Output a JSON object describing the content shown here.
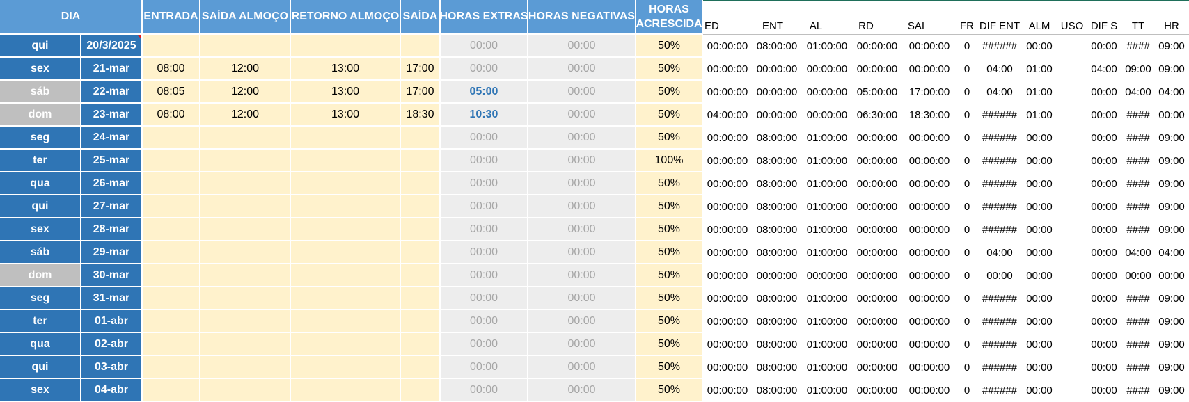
{
  "header": {
    "dia": "DIA",
    "entrada": "ENTRADA",
    "saida_almoco": "SAÍDA ALMOÇO",
    "retorno_almoco": "RETORNO ALMOÇO",
    "saida": "SAÍDA",
    "horas_extras": "HORAS EXTRAS",
    "horas_negativas": "HORAS NEGATIVAS",
    "horas_acrescida_1": "HORAS",
    "horas_acrescida_2": "ACRESCIDA"
  },
  "aux_header": {
    "ed": "ED",
    "ent": "ENT",
    "al": "AL",
    "rd": "RD",
    "sai": "SAI",
    "fr": "FR",
    "dif_ent": "DIF ENT",
    "alm": "ALM",
    "uso": "USO",
    "dif_s": "DIF S",
    "tt": "TT",
    "hr": "HR"
  },
  "colors": {
    "header_blue": "#5b9bd5",
    "day_blue": "#2f75b5",
    "weekend_gray": "#bfbfbf",
    "input_yellow": "#fff2cc",
    "calc_gray": "#ededed"
  },
  "rows": [
    {
      "day": "qui",
      "date": "20/3/2025",
      "entrada": "",
      "saida_almoco": "",
      "retorno": "",
      "saida": "",
      "extras": "00:00",
      "negativas": "00:00",
      "pct": "50%",
      "ed": "00:00:00",
      "ent": "08:00:00",
      "al": "01:00:00",
      "rd": "00:00:00",
      "sai": "00:00:00",
      "fr": "0",
      "dif_ent": "######",
      "alm": "00:00",
      "uso": "",
      "dif_s": "00:00",
      "tt": "####",
      "hr": "09:00",
      "weekend": false,
      "extras_hi": false
    },
    {
      "day": "sex",
      "date": "21-mar",
      "entrada": "08:00",
      "saida_almoco": "12:00",
      "retorno": "13:00",
      "saida": "17:00",
      "extras": "00:00",
      "negativas": "00:00",
      "pct": "50%",
      "ed": "00:00:00",
      "ent": "00:00:00",
      "al": "00:00:00",
      "rd": "00:00:00",
      "sai": "00:00:00",
      "fr": "0",
      "dif_ent": "04:00",
      "alm": "01:00",
      "uso": "",
      "dif_s": "04:00",
      "tt": "09:00",
      "hr": "09:00",
      "weekend": false,
      "extras_hi": false
    },
    {
      "day": "sáb",
      "date": "22-mar",
      "entrada": "08:05",
      "saida_almoco": "12:00",
      "retorno": "13:00",
      "saida": "17:00",
      "extras": "05:00",
      "negativas": "00:00",
      "pct": "50%",
      "ed": "00:00:00",
      "ent": "00:00:00",
      "al": "00:00:00",
      "rd": "05:00:00",
      "sai": "17:00:00",
      "fr": "0",
      "dif_ent": "04:00",
      "alm": "01:00",
      "uso": "",
      "dif_s": "00:00",
      "tt": "04:00",
      "hr": "04:00",
      "weekend": true,
      "extras_hi": true
    },
    {
      "day": "dom",
      "date": "23-mar",
      "entrada": "08:00",
      "saida_almoco": "12:00",
      "retorno": "13:00",
      "saida": "18:30",
      "extras": "10:30",
      "negativas": "00:00",
      "pct": "50%",
      "ed": "04:00:00",
      "ent": "00:00:00",
      "al": "00:00:00",
      "rd": "06:30:00",
      "sai": "18:30:00",
      "fr": "0",
      "dif_ent": "######",
      "alm": "01:00",
      "uso": "",
      "dif_s": "00:00",
      "tt": "####",
      "hr": "00:00",
      "weekend": true,
      "extras_hi": true
    },
    {
      "day": "seg",
      "date": "24-mar",
      "entrada": "",
      "saida_almoco": "",
      "retorno": "",
      "saida": "",
      "extras": "00:00",
      "negativas": "00:00",
      "pct": "50%",
      "ed": "00:00:00",
      "ent": "08:00:00",
      "al": "01:00:00",
      "rd": "00:00:00",
      "sai": "00:00:00",
      "fr": "0",
      "dif_ent": "######",
      "alm": "00:00",
      "uso": "",
      "dif_s": "00:00",
      "tt": "####",
      "hr": "09:00",
      "weekend": false,
      "extras_hi": false
    },
    {
      "day": "ter",
      "date": "25-mar",
      "entrada": "",
      "saida_almoco": "",
      "retorno": "",
      "saida": "",
      "extras": "00:00",
      "negativas": "00:00",
      "pct": "100%",
      "ed": "00:00:00",
      "ent": "08:00:00",
      "al": "01:00:00",
      "rd": "00:00:00",
      "sai": "00:00:00",
      "fr": "0",
      "dif_ent": "######",
      "alm": "00:00",
      "uso": "",
      "dif_s": "00:00",
      "tt": "####",
      "hr": "09:00",
      "weekend": false,
      "extras_hi": false
    },
    {
      "day": "qua",
      "date": "26-mar",
      "entrada": "",
      "saida_almoco": "",
      "retorno": "",
      "saida": "",
      "extras": "00:00",
      "negativas": "00:00",
      "pct": "50%",
      "ed": "00:00:00",
      "ent": "08:00:00",
      "al": "01:00:00",
      "rd": "00:00:00",
      "sai": "00:00:00",
      "fr": "0",
      "dif_ent": "######",
      "alm": "00:00",
      "uso": "",
      "dif_s": "00:00",
      "tt": "####",
      "hr": "09:00",
      "weekend": false,
      "extras_hi": false
    },
    {
      "day": "qui",
      "date": "27-mar",
      "entrada": "",
      "saida_almoco": "",
      "retorno": "",
      "saida": "",
      "extras": "00:00",
      "negativas": "00:00",
      "pct": "50%",
      "ed": "00:00:00",
      "ent": "08:00:00",
      "al": "01:00:00",
      "rd": "00:00:00",
      "sai": "00:00:00",
      "fr": "0",
      "dif_ent": "######",
      "alm": "00:00",
      "uso": "",
      "dif_s": "00:00",
      "tt": "####",
      "hr": "09:00",
      "weekend": false,
      "extras_hi": false
    },
    {
      "day": "sex",
      "date": "28-mar",
      "entrada": "",
      "saida_almoco": "",
      "retorno": "",
      "saida": "",
      "extras": "00:00",
      "negativas": "00:00",
      "pct": "50%",
      "ed": "00:00:00",
      "ent": "08:00:00",
      "al": "01:00:00",
      "rd": "00:00:00",
      "sai": "00:00:00",
      "fr": "0",
      "dif_ent": "######",
      "alm": "00:00",
      "uso": "",
      "dif_s": "00:00",
      "tt": "####",
      "hr": "09:00",
      "weekend": false,
      "extras_hi": false
    },
    {
      "day": "sáb",
      "date": "29-mar",
      "entrada": "",
      "saida_almoco": "",
      "retorno": "",
      "saida": "",
      "extras": "00:00",
      "negativas": "00:00",
      "pct": "50%",
      "ed": "00:00:00",
      "ent": "08:00:00",
      "al": "01:00:00",
      "rd": "00:00:00",
      "sai": "00:00:00",
      "fr": "0",
      "dif_ent": "04:00",
      "alm": "00:00",
      "uso": "",
      "dif_s": "00:00",
      "tt": "04:00",
      "hr": "04:00",
      "weekend": false,
      "extras_hi": false
    },
    {
      "day": "dom",
      "date": "30-mar",
      "entrada": "",
      "saida_almoco": "",
      "retorno": "",
      "saida": "",
      "extras": "00:00",
      "negativas": "00:00",
      "pct": "50%",
      "ed": "00:00:00",
      "ent": "00:00:00",
      "al": "00:00:00",
      "rd": "00:00:00",
      "sai": "00:00:00",
      "fr": "0",
      "dif_ent": "00:00",
      "alm": "00:00",
      "uso": "",
      "dif_s": "00:00",
      "tt": "00:00",
      "hr": "00:00",
      "weekend": true,
      "extras_hi": false
    },
    {
      "day": "seg",
      "date": "31-mar",
      "entrada": "",
      "saida_almoco": "",
      "retorno": "",
      "saida": "",
      "extras": "00:00",
      "negativas": "00:00",
      "pct": "50%",
      "ed": "00:00:00",
      "ent": "08:00:00",
      "al": "01:00:00",
      "rd": "00:00:00",
      "sai": "00:00:00",
      "fr": "0",
      "dif_ent": "######",
      "alm": "00:00",
      "uso": "",
      "dif_s": "00:00",
      "tt": "####",
      "hr": "09:00",
      "weekend": false,
      "extras_hi": false
    },
    {
      "day": "ter",
      "date": "01-abr",
      "entrada": "",
      "saida_almoco": "",
      "retorno": "",
      "saida": "",
      "extras": "00:00",
      "negativas": "00:00",
      "pct": "50%",
      "ed": "00:00:00",
      "ent": "08:00:00",
      "al": "01:00:00",
      "rd": "00:00:00",
      "sai": "00:00:00",
      "fr": "0",
      "dif_ent": "######",
      "alm": "00:00",
      "uso": "",
      "dif_s": "00:00",
      "tt": "####",
      "hr": "09:00",
      "weekend": false,
      "extras_hi": false
    },
    {
      "day": "qua",
      "date": "02-abr",
      "entrada": "",
      "saida_almoco": "",
      "retorno": "",
      "saida": "",
      "extras": "00:00",
      "negativas": "00:00",
      "pct": "50%",
      "ed": "00:00:00",
      "ent": "08:00:00",
      "al": "01:00:00",
      "rd": "00:00:00",
      "sai": "00:00:00",
      "fr": "0",
      "dif_ent": "######",
      "alm": "00:00",
      "uso": "",
      "dif_s": "00:00",
      "tt": "####",
      "hr": "09:00",
      "weekend": false,
      "extras_hi": false
    },
    {
      "day": "qui",
      "date": "03-abr",
      "entrada": "",
      "saida_almoco": "",
      "retorno": "",
      "saida": "",
      "extras": "00:00",
      "negativas": "00:00",
      "pct": "50%",
      "ed": "00:00:00",
      "ent": "08:00:00",
      "al": "01:00:00",
      "rd": "00:00:00",
      "sai": "00:00:00",
      "fr": "0",
      "dif_ent": "######",
      "alm": "00:00",
      "uso": "",
      "dif_s": "00:00",
      "tt": "####",
      "hr": "09:00",
      "weekend": false,
      "extras_hi": false
    },
    {
      "day": "sex",
      "date": "04-abr",
      "entrada": "",
      "saida_almoco": "",
      "retorno": "",
      "saida": "",
      "extras": "00:00",
      "negativas": "00:00",
      "pct": "50%",
      "ed": "00:00:00",
      "ent": "08:00:00",
      "al": "01:00:00",
      "rd": "00:00:00",
      "sai": "00:00:00",
      "fr": "0",
      "dif_ent": "######",
      "alm": "00:00",
      "uso": "",
      "dif_s": "00:00",
      "tt": "####",
      "hr": "09:00",
      "weekend": false,
      "extras_hi": false
    }
  ]
}
